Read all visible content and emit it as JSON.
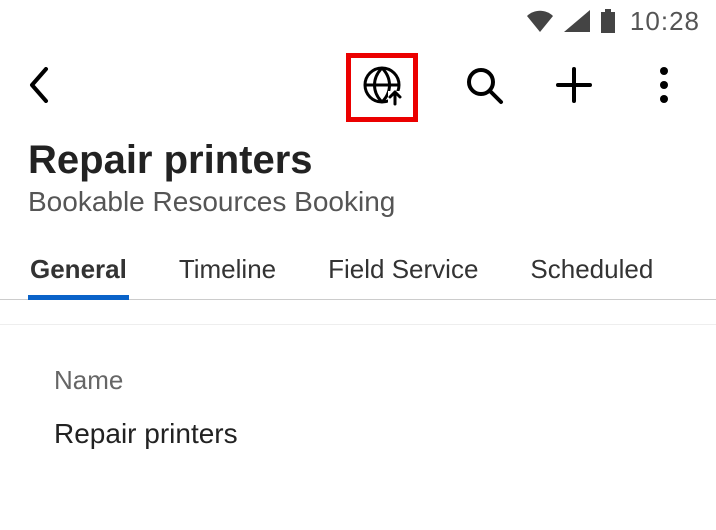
{
  "status": {
    "time": "10:28"
  },
  "header": {
    "title": "Repair printers",
    "subtitle": "Bookable Resources Booking"
  },
  "tabs": [
    {
      "label": "General",
      "active": true
    },
    {
      "label": "Timeline",
      "active": false
    },
    {
      "label": "Field Service",
      "active": false
    },
    {
      "label": "Scheduled",
      "active": false
    }
  ],
  "form": {
    "name_label": "Name",
    "name_value": "Repair printers"
  },
  "colors": {
    "highlight": "#eb0000",
    "tab_indicator": "#0a63c9"
  }
}
